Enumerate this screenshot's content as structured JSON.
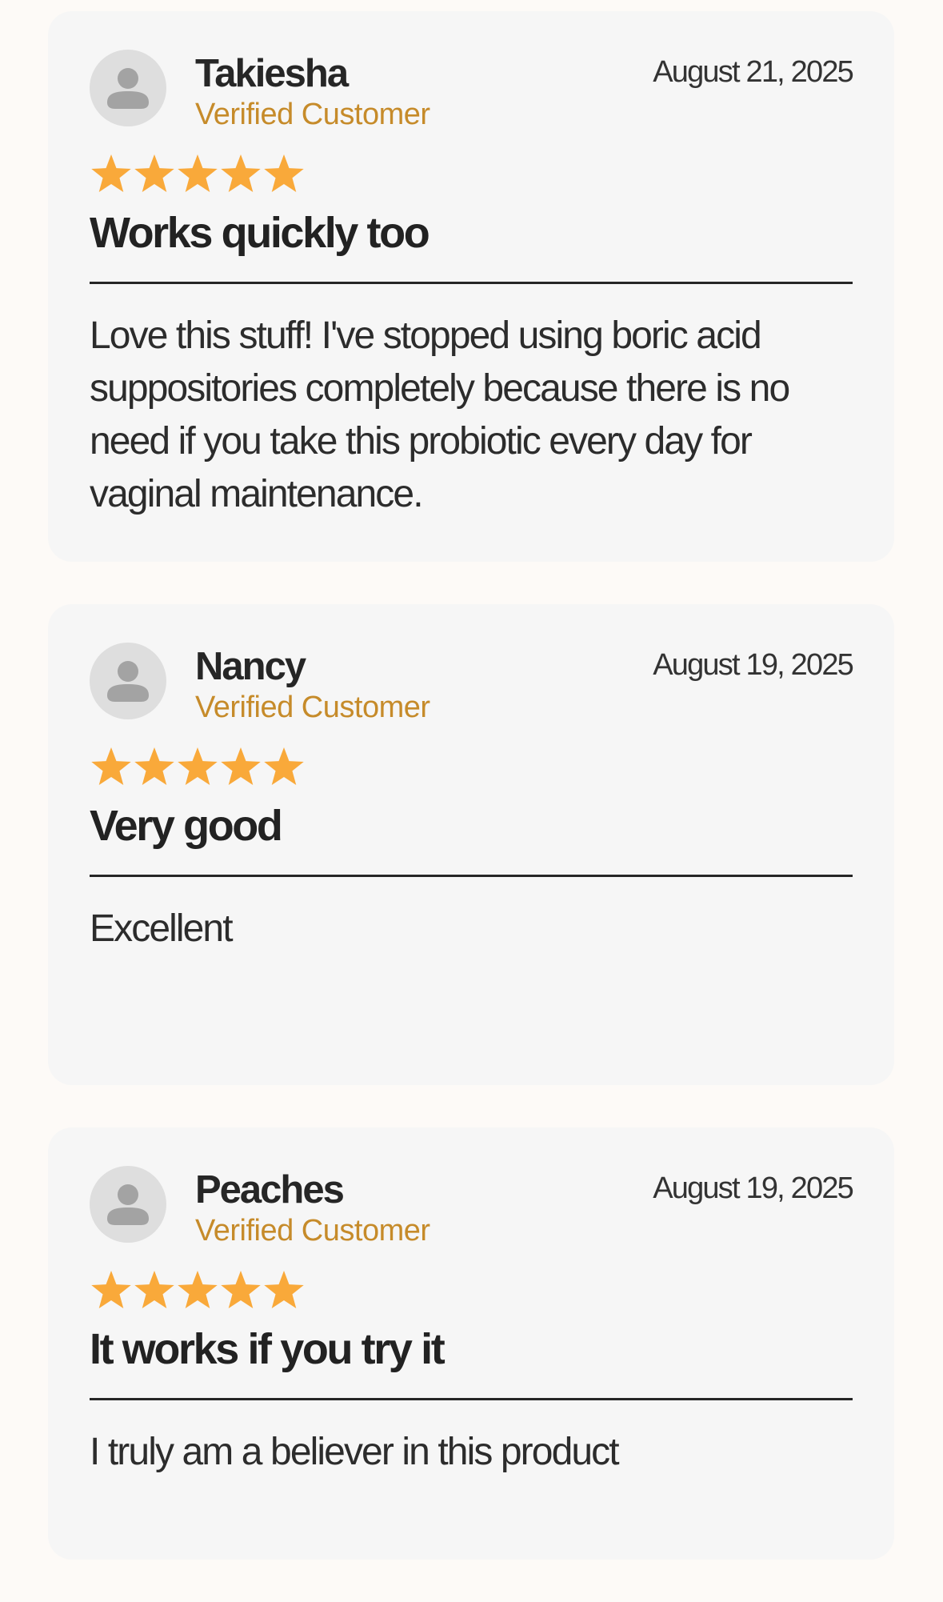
{
  "reviews": [
    {
      "author": "Takiesha",
      "badge": "Verified Customer",
      "date": "August 21, 2025",
      "rating": 5,
      "rating_max": 5,
      "title": "Works quickly too",
      "body": "Love this stuff! I've stopped using boric acid suppositories completely because there is no need if you take this probiotic every day for vaginal maintenance."
    },
    {
      "author": "Nancy",
      "badge": "Verified Customer",
      "date": "August 19, 2025",
      "rating": 5,
      "rating_max": 5,
      "title": "Very good",
      "body": "Excellent"
    },
    {
      "author": "Peaches",
      "badge": "Verified Customer",
      "date": "August 19, 2025",
      "rating": 5,
      "rating_max": 5,
      "title": "It works if you try it",
      "body": "I truly am a believer in this product"
    }
  ],
  "icons": {
    "avatar": "user-silhouette-icon",
    "star": "star-filled-icon"
  },
  "colors": {
    "star": "#f9a93a",
    "badge": "#c68b2a",
    "card_background": "#f6f6f6",
    "page_background": "#fdfaf7",
    "avatar_background": "#dedede",
    "avatar_figure": "#a3a3a3"
  }
}
